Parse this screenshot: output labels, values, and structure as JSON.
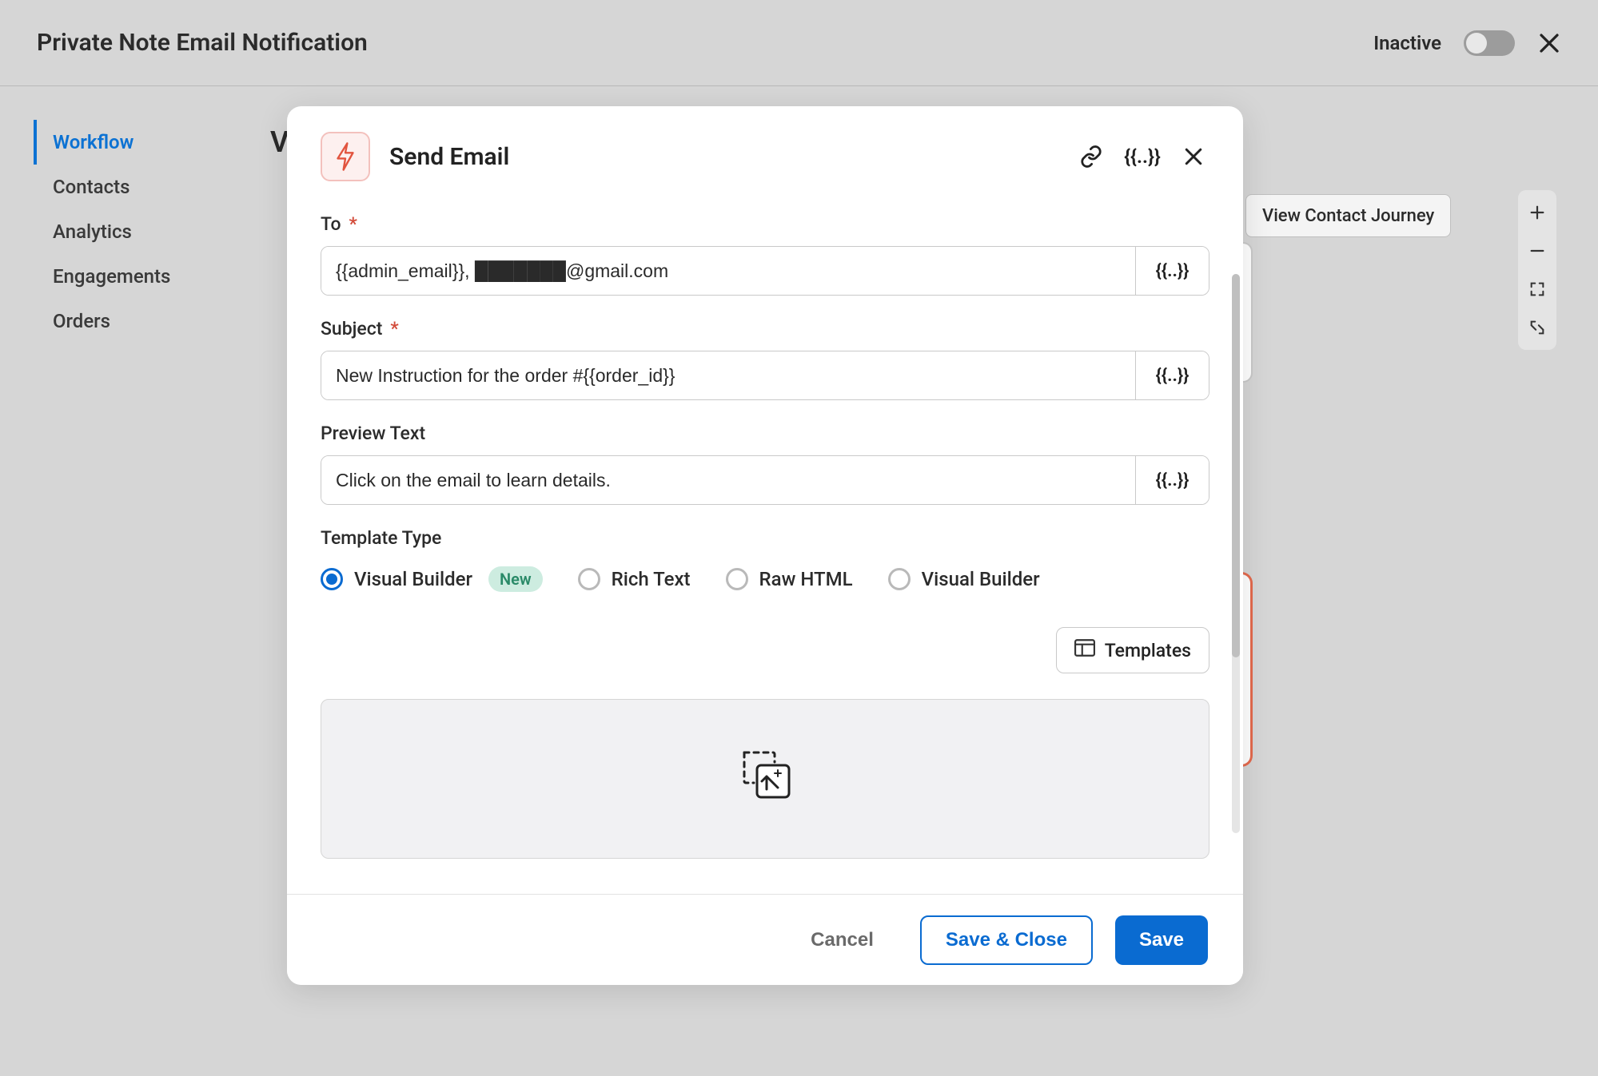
{
  "header": {
    "title": "Private Note Email Notification",
    "status_label": "Inactive"
  },
  "sidebar": {
    "items": [
      {
        "label": "Workflow",
        "active": true
      },
      {
        "label": "Contacts",
        "active": false
      },
      {
        "label": "Analytics",
        "active": false
      },
      {
        "label": "Engagements",
        "active": false
      },
      {
        "label": "Orders",
        "active": false
      }
    ]
  },
  "canvas": {
    "partial_heading_char": "V",
    "view_journey_label": "View Contact Journey"
  },
  "modal": {
    "title": "Send Email",
    "to": {
      "label": "To",
      "required": true,
      "value": "{{admin_email}}, ███████@gmail.com"
    },
    "subject": {
      "label": "Subject",
      "required": true,
      "value": "New Instruction for the order #{{order_id}}"
    },
    "preview": {
      "label": "Preview Text",
      "required": false,
      "value": "Click on the email to learn details."
    },
    "template_type": {
      "label": "Template Type",
      "new_badge": "New",
      "options": [
        {
          "label": "Visual Builder",
          "selected": true,
          "has_new_badge": true
        },
        {
          "label": "Rich Text",
          "selected": false,
          "has_new_badge": false
        },
        {
          "label": "Raw HTML",
          "selected": false,
          "has_new_badge": false
        },
        {
          "label": "Visual Builder",
          "selected": false,
          "has_new_badge": false
        }
      ]
    },
    "templates_button": "Templates",
    "footer": {
      "cancel": "Cancel",
      "save_close": "Save & Close",
      "save": "Save"
    }
  },
  "merge_tag_glyph": "{{..}}"
}
